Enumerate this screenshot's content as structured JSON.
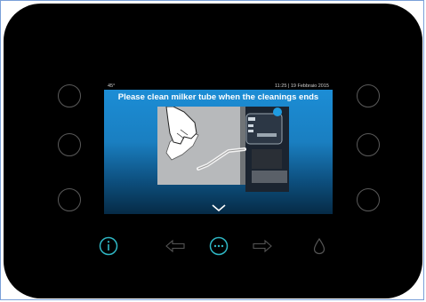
{
  "status": {
    "left_text": "45°",
    "right_text": "11:25 | 19 Febbraio 2015"
  },
  "screen": {
    "message": "Please clean milker tube when the cleanings ends"
  },
  "colors": {
    "accent": "#2fb7c4",
    "screen_top": "#1c8fd8",
    "screen_bottom": "#062b46"
  },
  "icons": [
    "info-icon",
    "arrow-left-icon",
    "more-icon",
    "arrow-right-icon",
    "drop-icon",
    "chevron-down-icon"
  ]
}
